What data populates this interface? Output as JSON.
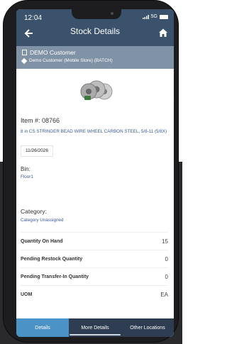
{
  "status_bar": {
    "time": "12:04",
    "network": "5G"
  },
  "header": {
    "title": "Stock Details"
  },
  "customer": {
    "name": "DEMO Customer",
    "store": "Demo Customer (Mobile Store) (BATCH)"
  },
  "item": {
    "number": "Item #: 08766",
    "description": "8 in CS STRINGER BEAD WIRE WHEEL CARBON STEEL, 5/8-11 (5/8X)",
    "date": "11/26/2026"
  },
  "bin": {
    "label": "Bin:",
    "value": "Floor1"
  },
  "category": {
    "label": "Category:",
    "value": "Category Unassigned"
  },
  "details": [
    {
      "label": "Quantity On Hand",
      "value": "15"
    },
    {
      "label": "Pending Restock Quantity",
      "value": "0"
    },
    {
      "label": "Pending Transfer-In Quantity",
      "value": "0"
    },
    {
      "label": "UOM",
      "value": "EA"
    }
  ],
  "tabs": [
    "Details",
    "More Details",
    "Other Locations"
  ],
  "colors": {
    "app_bar": "#3a526b",
    "customer_bar": "#8092a5",
    "tab_bar": "#2e3d51",
    "active_tab": "#4b93c6",
    "link_text": "#3a5a9a"
  }
}
